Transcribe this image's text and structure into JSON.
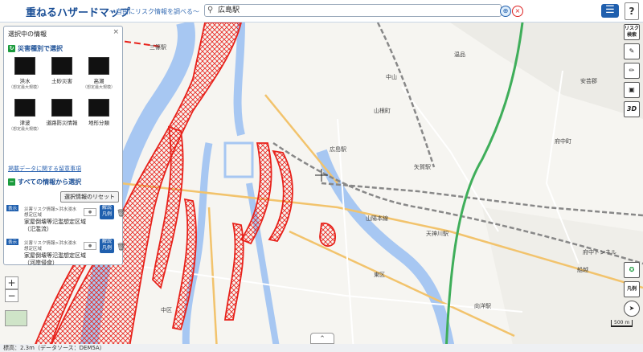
{
  "header": {
    "title": "重ねるハザードマップ",
    "subtitle": "〜自由にリスク情報を調べる〜",
    "search_value": "広島駅"
  },
  "panel": {
    "title": "選択中の情報",
    "close": "×",
    "by_hazard_heading": "災害種別で選択",
    "hazards": [
      {
        "label": "洪水",
        "sub": "（想定最大規模）",
        "icon": "flood-icon"
      },
      {
        "label": "土砂災害",
        "sub": "",
        "icon": "landslide-icon"
      },
      {
        "label": "高潮",
        "sub": "（想定最大規模）",
        "icon": "storm-surge-icon"
      },
      {
        "label": "津波",
        "sub": "（想定最大規模）",
        "icon": "tsunami-icon"
      },
      {
        "label": "道路防災情報",
        "sub": "",
        "icon": "road-icon"
      },
      {
        "label": "地形分類",
        "sub": "",
        "icon": "terrain-icon"
      }
    ],
    "notes_link": "掲載データに関する留意事項",
    "all_info_heading": "すべての情報から選択",
    "reset_label": "選択情報のリセット",
    "layers": [
      {
        "tag": "表示",
        "source": "災害リスク情報>洪水浸水想定区域",
        "name": "家屋倒壊等氾濫想定区域（氾濫流）",
        "legend": "解説 凡例"
      },
      {
        "tag": "表示",
        "source": "災害リスク情報>洪水浸水想定区域",
        "name": "家屋倒壊等氾濫想定区域（河岸侵食）",
        "legend": "解説 凡例"
      }
    ]
  },
  "right_toolbar": {
    "risk_label": "リスク検索",
    "3d_label": "3D",
    "legend_label": "凡例"
  },
  "zoom": {
    "plus": "+",
    "minus": "−"
  },
  "map_labels": {
    "sanjo": "三篠駅",
    "hiroshima_eki": "広島駅",
    "yaga": "矢賀駅",
    "sanyo": "山陽本線",
    "tenjin": "天神川駅",
    "mukainada": "向洋駅",
    "naka_ku": "中区",
    "aki_gun": "安芸郡",
    "fuchu": "府中町",
    "tunnel": "府中トンネル",
    "yamane": "山根町",
    "nakayama": "中山",
    "onsen": "温品",
    "higashi": "東区",
    "funakoshi": "船越"
  },
  "scale_label": "500 m",
  "status_text": "標高：2.3m（データソース：DEM5A）",
  "colors": {
    "accent": "#1f5fae",
    "hazard": "#e8221b",
    "river": "#a7c7f2",
    "rail": "#3fae5a"
  }
}
